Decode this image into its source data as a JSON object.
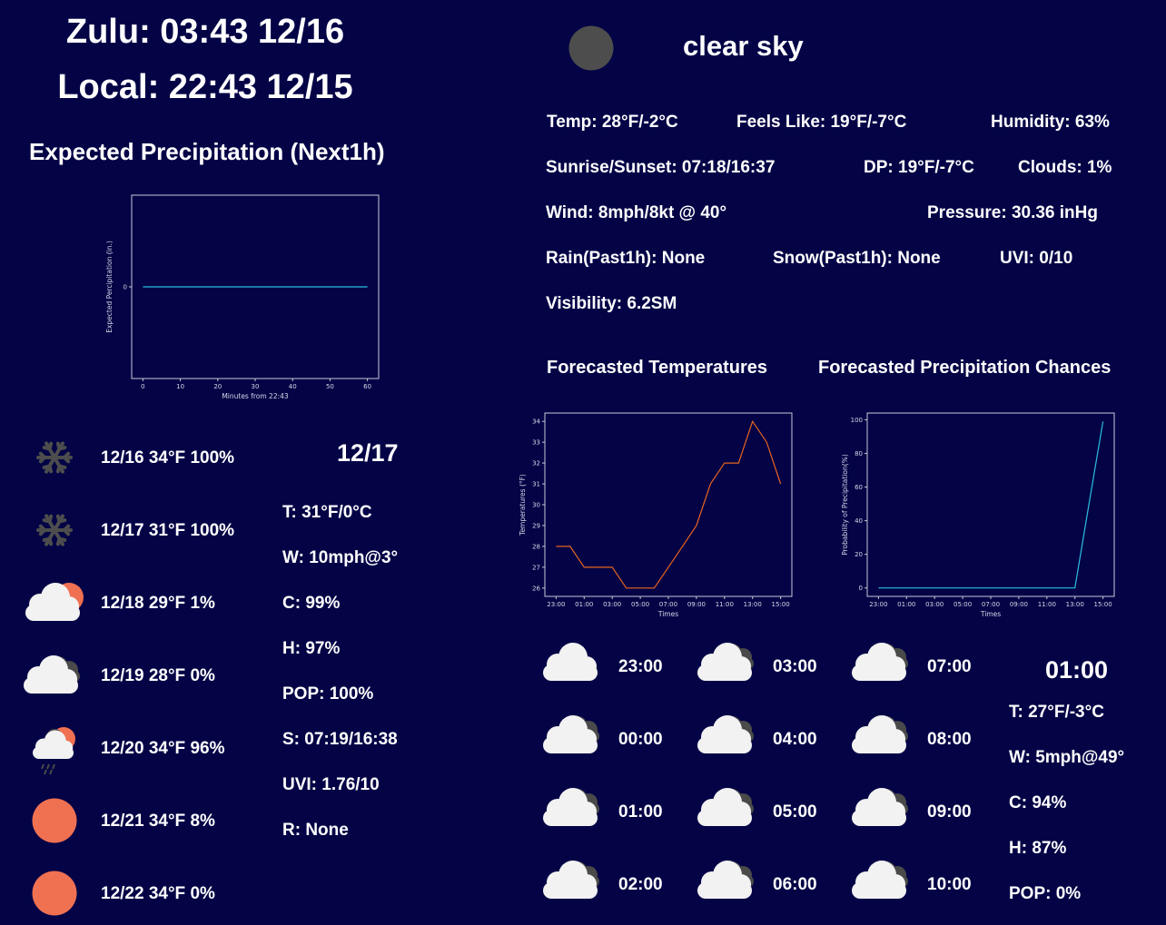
{
  "clock": {
    "zulu": "Zulu: 03:43 12/16",
    "local": "Local: 22:43 12/15"
  },
  "precip_next1h": {
    "title": "Expected Precipitation (Next1h)"
  },
  "current": {
    "icon": "moon-icon",
    "description": "clear sky",
    "temp": "Temp: 28°F/-2°C",
    "feels_like": "Feels Like: 19°F/-7°C",
    "humidity": "Humidity: 63%",
    "sunrise_sunset": "Sunrise/Sunset: 07:18/16:37",
    "dew_point": "DP: 19°F/-7°C",
    "clouds": "Clouds: 1%",
    "wind": "Wind: 8mph/8kt @ 40°",
    "pressure": "Pressure: 30.36 inHg",
    "rain": "Rain(Past1h): None",
    "snow": "Snow(Past1h): None",
    "uvi": "UVI: 0/10",
    "visibility": "Visibility: 6.2SM"
  },
  "forecast_titles": {
    "temperatures": "Forecasted Temperatures",
    "precip_chances": "Forecasted Precipitation Chances"
  },
  "daily": [
    {
      "icon": "snowflake-icon",
      "text": "12/16 34°F 100%"
    },
    {
      "icon": "snowflake-icon",
      "text": "12/17 31°F 100%"
    },
    {
      "icon": "cloud-sun-icon",
      "text": "12/18 29°F 1%"
    },
    {
      "icon": "cloudy-icon",
      "text": "12/19 28°F 0%"
    },
    {
      "icon": "rain-sun-icon",
      "text": "12/20 34°F 96%"
    },
    {
      "icon": "sun-icon",
      "text": "12/21 34°F 8%"
    },
    {
      "icon": "sun-icon",
      "text": "12/22 34°F 0%"
    }
  ],
  "day_detail": {
    "date": "12/17",
    "temp": "T: 31°F/0°C",
    "wind": "W: 10mph@3°",
    "clouds": "C: 99%",
    "humidity": "H: 97%",
    "pop": "POP: 100%",
    "sun": "S: 07:19/16:38",
    "uvi": "UVI: 1.76/10",
    "rain": "R: None"
  },
  "hourly": [
    {
      "time": "23:00",
      "icon": "cloud-icon"
    },
    {
      "time": "00:00",
      "icon": "cloudy-icon"
    },
    {
      "time": "01:00",
      "icon": "cloudy-icon"
    },
    {
      "time": "02:00",
      "icon": "cloudy-icon"
    },
    {
      "time": "03:00",
      "icon": "cloudy-icon"
    },
    {
      "time": "04:00",
      "icon": "cloudy-icon"
    },
    {
      "time": "05:00",
      "icon": "cloudy-icon"
    },
    {
      "time": "06:00",
      "icon": "cloudy-icon"
    },
    {
      "time": "07:00",
      "icon": "cloudy-icon"
    },
    {
      "time": "08:00",
      "icon": "cloudy-icon"
    },
    {
      "time": "09:00",
      "icon": "cloudy-icon"
    },
    {
      "time": "10:00",
      "icon": "cloudy-icon"
    }
  ],
  "hour_detail": {
    "time": "01:00",
    "temp": "T: 27°F/-3°C",
    "wind": "W: 5mph@49°",
    "clouds": "C: 94%",
    "humidity": "H: 87%",
    "pop": "POP: 0%"
  },
  "colors": {
    "background": "#030346",
    "temp_line": "#e8641e",
    "precip_line": "#2bbfe0",
    "sun": "#ef7152",
    "moon": "#4d4d4d"
  },
  "chart_data": [
    {
      "type": "line",
      "id": "next1h",
      "title": "",
      "xlabel": "Minutes from 22:43",
      "ylabel": "Expected Percipitation (in.)",
      "x": [
        0,
        60
      ],
      "y": [
        0,
        0
      ],
      "xticks": [
        0,
        10,
        20,
        30,
        40,
        50,
        60
      ],
      "yticks": [
        0
      ],
      "xlim": [
        -3,
        63
      ],
      "ylim": [
        -0.055,
        0.055
      ]
    },
    {
      "type": "line",
      "id": "temps",
      "title": "",
      "xlabel": "Times",
      "ylabel": "Temperatures (°F)",
      "x": [
        "23:00",
        "00:00",
        "01:00",
        "02:00",
        "03:00",
        "04:00",
        "05:00",
        "06:00",
        "07:00",
        "08:00",
        "09:00",
        "10:00",
        "11:00",
        "12:00",
        "13:00",
        "14:00",
        "15:00"
      ],
      "y": [
        28,
        28,
        27,
        27,
        27,
        26,
        26,
        26,
        27,
        28,
        29,
        31,
        32,
        32,
        34,
        33,
        31
      ],
      "xticks": [
        "23:00",
        "01:00",
        "03:00",
        "05:00",
        "07:00",
        "09:00",
        "11:00",
        "13:00",
        "15:00"
      ],
      "yticks": [
        26,
        27,
        28,
        29,
        30,
        31,
        32,
        33,
        34
      ],
      "ylim": [
        25.6,
        34.4
      ]
    },
    {
      "type": "line",
      "id": "pop",
      "title": "",
      "xlabel": "Times",
      "ylabel": "Probability of Precipitation(%)",
      "x": [
        "23:00",
        "00:00",
        "01:00",
        "02:00",
        "03:00",
        "04:00",
        "05:00",
        "06:00",
        "07:00",
        "08:00",
        "09:00",
        "10:00",
        "11:00",
        "12:00",
        "13:00",
        "14:00",
        "15:00"
      ],
      "y": [
        0,
        0,
        0,
        0,
        0,
        0,
        0,
        0,
        0,
        0,
        0,
        0,
        0,
        0,
        0,
        50,
        99
      ],
      "xticks": [
        "23:00",
        "01:00",
        "03:00",
        "05:00",
        "07:00",
        "09:00",
        "11:00",
        "13:00",
        "15:00"
      ],
      "yticks": [
        0,
        20,
        40,
        60,
        80,
        100
      ],
      "ylim": [
        -5,
        104
      ]
    }
  ]
}
